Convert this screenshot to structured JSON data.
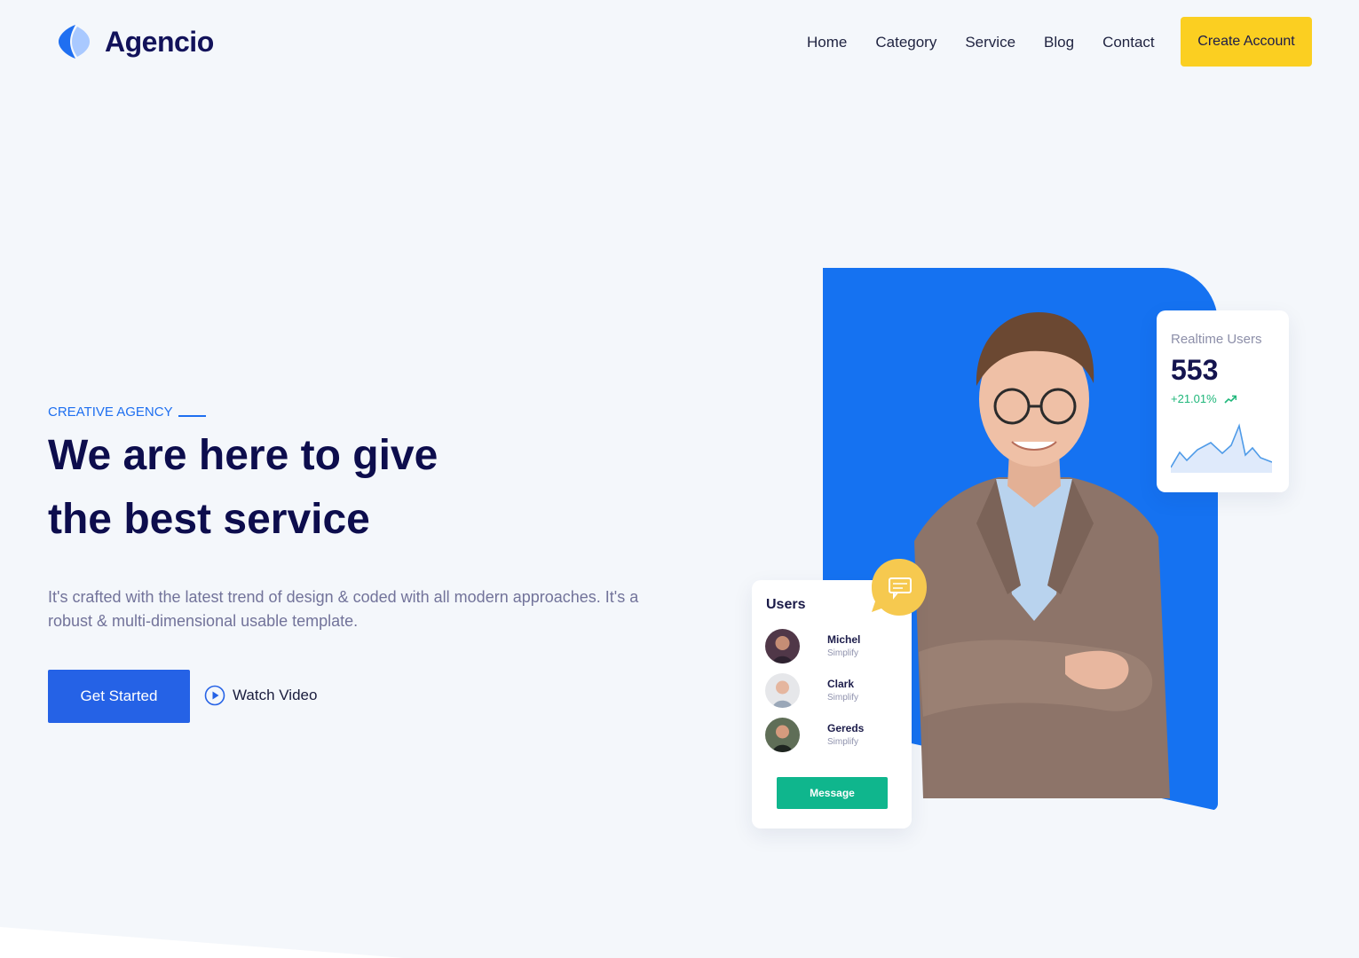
{
  "brand": {
    "name": "Agencio"
  },
  "nav": {
    "items": [
      {
        "label": "Home"
      },
      {
        "label": "Category"
      },
      {
        "label": "Service"
      },
      {
        "label": "Blog"
      },
      {
        "label": "Contact"
      }
    ],
    "cta_label": "Create Account"
  },
  "hero": {
    "eyebrow": "CREATIVE AGENCY",
    "headline_line1": "We are here to give",
    "headline_line2": "the best service",
    "lead": "It's crafted with the latest trend of design & coded with all modern approaches. It's a robust & multi-dimensional usable template.",
    "primary_cta": "Get Started",
    "secondary_cta": "Watch Video"
  },
  "stats": {
    "title": "Realtime Users",
    "value": "553",
    "change": "+21.01%",
    "trend_icon": "trending-up-icon"
  },
  "users_card": {
    "title": "Users",
    "users": [
      {
        "name": "Michel",
        "subtitle": "Simplify"
      },
      {
        "name": "Clark",
        "subtitle": "Simplify"
      },
      {
        "name": "Gereds",
        "subtitle": "Simplify"
      }
    ],
    "button_label": "Message"
  },
  "colors": {
    "primary_blue": "#2562e6",
    "panel_blue": "#1572f1",
    "accent_yellow": "#fbcf21",
    "success_green": "#0fb68d",
    "heading_navy": "#0d0d4d",
    "background": "#f4f7fb"
  }
}
